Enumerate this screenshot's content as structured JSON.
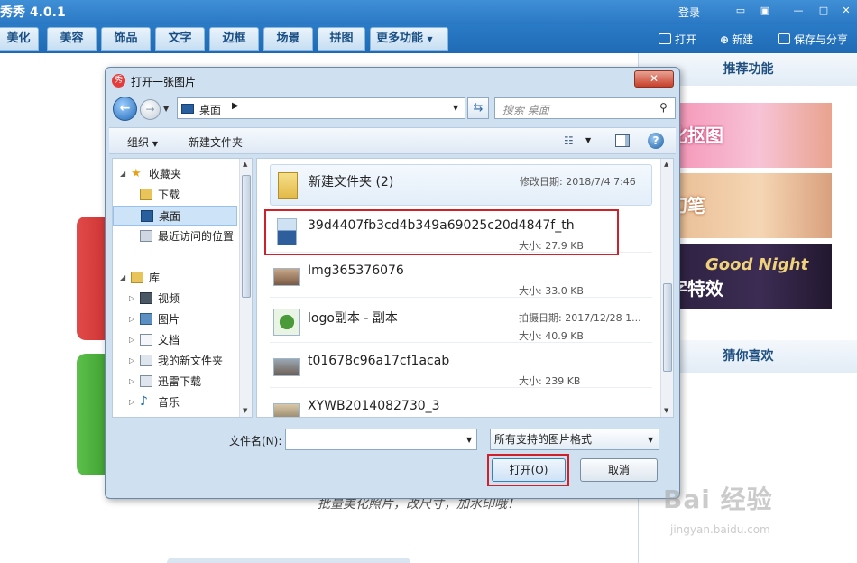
{
  "app": {
    "title": "秀秀 4.0.1",
    "login": "登录",
    "menu_tabs": [
      "美化",
      "美容",
      "饰品",
      "文字",
      "边框",
      "场景",
      "拼图",
      "更多功能"
    ],
    "actions": {
      "open": "打开",
      "new": "新建",
      "save": "保存与分享"
    }
  },
  "right_panel": {
    "recommend_header": "推荐功能",
    "promos": [
      "优化抠图",
      "魔幻笔",
      "文字特效"
    ],
    "promo_overlay": "Good Night",
    "likes_header": "猜你喜欢"
  },
  "canvas": {
    "hint": "批量美化照片，改尺寸，加水印哦！"
  },
  "dialog": {
    "title": "打开一张图片",
    "close": "✕",
    "address": {
      "location": "桌面"
    },
    "search_placeholder": "搜索 桌面",
    "toolbar": {
      "organize": "组织",
      "new_folder": "新建文件夹"
    },
    "nav": [
      {
        "label": "收藏夹",
        "indent": 0
      },
      {
        "label": "下载",
        "indent": 1
      },
      {
        "label": "桌面",
        "indent": 1,
        "selected": true
      },
      {
        "label": "最近访问的位置",
        "indent": 1
      },
      {
        "label": "库",
        "indent": 0
      },
      {
        "label": "视频",
        "indent": 1
      },
      {
        "label": "图片",
        "indent": 1
      },
      {
        "label": "文档",
        "indent": 1
      },
      {
        "label": "我的新文件夹",
        "indent": 1
      },
      {
        "label": "迅雷下载",
        "indent": 1
      },
      {
        "label": "音乐",
        "indent": 1
      }
    ],
    "files": [
      {
        "name": "新建文件夹 (2)",
        "meta": "修改日期: 2018/7/4 7:46",
        "size": ""
      },
      {
        "name": "39d4407fb3cd4b349a69025c20d4847f_th",
        "meta": "",
        "size": "大小: 27.9 KB"
      },
      {
        "name": "Img365376076",
        "meta": "",
        "size": "大小: 33.0 KB"
      },
      {
        "name": "logo副本 - 副本",
        "meta": "拍摄日期: 2017/12/28 1...",
        "size": "大小: 40.9 KB"
      },
      {
        "name": "t01678c96a17cf1acab",
        "meta": "",
        "size": "大小: 239 KB"
      },
      {
        "name": "XYWB2014082730_3",
        "meta": "",
        "size": ""
      }
    ],
    "filename_label": "文件名(N):",
    "filename_value": "",
    "filter": "所有支持的图片格式",
    "open_button": "打开(O)",
    "cancel_button": "取消"
  },
  "watermark": {
    "main": "Bai 经验",
    "sub": "jingyan.baidu.com"
  }
}
